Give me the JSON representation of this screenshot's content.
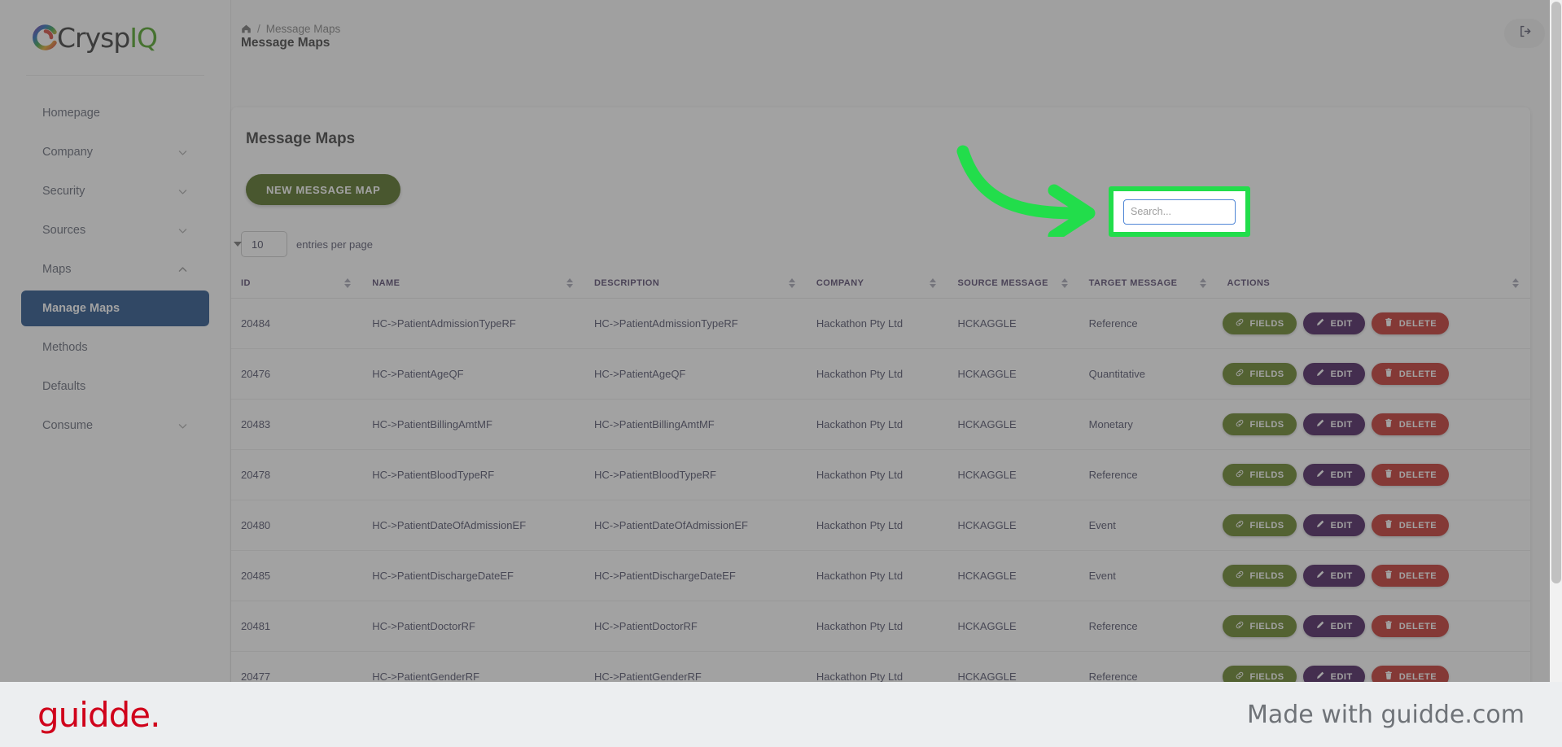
{
  "brand": {
    "name_main": "Crysp",
    "name_accent": "IQ",
    "accent_color": "#3f9c12"
  },
  "sidebar": {
    "items": [
      {
        "label": "Homepage",
        "has_chevron": false,
        "active": false,
        "sub": false
      },
      {
        "label": "Company",
        "has_chevron": true,
        "active": false,
        "sub": false
      },
      {
        "label": "Security",
        "has_chevron": true,
        "active": false,
        "sub": false
      },
      {
        "label": "Sources",
        "has_chevron": true,
        "active": false,
        "sub": false
      },
      {
        "label": "Maps",
        "has_chevron": true,
        "chevron_dir": "up",
        "active": false,
        "sub": false
      },
      {
        "label": "Manage Maps",
        "has_chevron": false,
        "active": true,
        "sub": true
      },
      {
        "label": "Methods",
        "has_chevron": false,
        "active": false,
        "sub": true
      },
      {
        "label": "Defaults",
        "has_chevron": false,
        "active": false,
        "sub": true
      },
      {
        "label": "Consume",
        "has_chevron": true,
        "active": false,
        "sub": false
      }
    ]
  },
  "topbar": {
    "breadcrumb_home_icon": "home-icon",
    "breadcrumb_separator": "/",
    "breadcrumb_current": "Message Maps",
    "page_title": "Message Maps",
    "logout_icon": "logout-icon"
  },
  "card": {
    "title": "Message Maps",
    "new_button": "NEW MESSAGE MAP",
    "entries_value": "10",
    "entries_label": "entries per page"
  },
  "search": {
    "placeholder": "Search...",
    "value": ""
  },
  "table": {
    "columns": [
      {
        "label": "ID",
        "sortable": true
      },
      {
        "label": "NAME",
        "sortable": true
      },
      {
        "label": "DESCRIPTION",
        "sortable": true
      },
      {
        "label": "COMPANY",
        "sortable": true
      },
      {
        "label": "SOURCE MESSAGE",
        "sortable": true
      },
      {
        "label": "TARGET MESSAGE",
        "sortable": true
      },
      {
        "label": "ACTIONS",
        "sortable": true
      }
    ],
    "action_labels": {
      "fields": "FIELDS",
      "edit": "EDIT",
      "delete": "DELETE"
    },
    "rows": [
      {
        "id": "20484",
        "name": "HC->PatientAdmissionTypeRF",
        "description": "HC->PatientAdmissionTypeRF",
        "company": "Hackathon Pty Ltd",
        "source": "HCKAGGLE",
        "target": "Reference"
      },
      {
        "id": "20476",
        "name": "HC->PatientAgeQF",
        "description": "HC->PatientAgeQF",
        "company": "Hackathon Pty Ltd",
        "source": "HCKAGGLE",
        "target": "Quantitative"
      },
      {
        "id": "20483",
        "name": "HC->PatientBillingAmtMF",
        "description": "HC->PatientBillingAmtMF",
        "company": "Hackathon Pty Ltd",
        "source": "HCKAGGLE",
        "target": "Monetary"
      },
      {
        "id": "20478",
        "name": "HC->PatientBloodTypeRF",
        "description": "HC->PatientBloodTypeRF",
        "company": "Hackathon Pty Ltd",
        "source": "HCKAGGLE",
        "target": "Reference"
      },
      {
        "id": "20480",
        "name": "HC->PatientDateOfAdmissionEF",
        "description": "HC->PatientDateOfAdmissionEF",
        "company": "Hackathon Pty Ltd",
        "source": "HCKAGGLE",
        "target": "Event"
      },
      {
        "id": "20485",
        "name": "HC->PatientDischargeDateEF",
        "description": "HC->PatientDischargeDateEF",
        "company": "Hackathon Pty Ltd",
        "source": "HCKAGGLE",
        "target": "Event"
      },
      {
        "id": "20481",
        "name": "HC->PatientDoctorRF",
        "description": "HC->PatientDoctorRF",
        "company": "Hackathon Pty Ltd",
        "source": "HCKAGGLE",
        "target": "Reference"
      },
      {
        "id": "20477",
        "name": "HC->PatientGenderRF",
        "description": "HC->PatientGenderRF",
        "company": "Hackathon Pty Ltd",
        "source": "HCKAGGLE",
        "target": "Reference"
      }
    ]
  },
  "annotation": {
    "arrow_color": "#22dd4b",
    "highlight_color": "#22dd4b"
  },
  "footer": {
    "logo_text": "guidde.",
    "made_with": "Made with guidde.com"
  }
}
